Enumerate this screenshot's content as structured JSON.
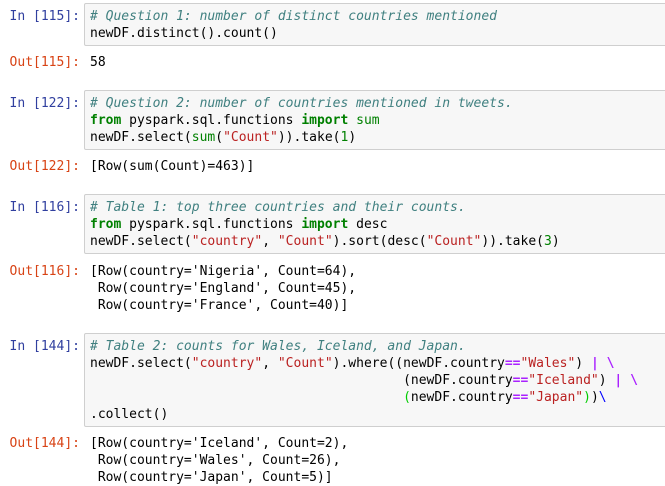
{
  "cells": [
    {
      "in_prompt": "In [115]:",
      "out_prompt": "Out[115]:",
      "code": [
        "# Question 1: number of distinct countries mentioned",
        "newDF.distinct().count()"
      ],
      "output": [
        "58"
      ]
    },
    {
      "in_prompt": "In [122]:",
      "out_prompt": "Out[122]:",
      "code": [
        "# Question 2: number of countries mentioned in tweets.",
        "from pyspark.sql.functions import sum",
        "newDF.select(sum(\"Count\")).take(1)"
      ],
      "output": [
        "[Row(sum(Count)=463)]"
      ]
    },
    {
      "in_prompt": "In [116]:",
      "out_prompt": "Out[116]:",
      "code": [
        "# Table 1: top three countries and their counts.",
        "from pyspark.sql.functions import desc",
        "newDF.select(\"country\", \"Count\").sort(desc(\"Count\")).take(3)"
      ],
      "output": [
        "[Row(country='Nigeria', Count=64),",
        " Row(country='England', Count=45),",
        " Row(country='France', Count=40)]"
      ]
    },
    {
      "in_prompt": "In [144]:",
      "out_prompt": "Out[144]:",
      "code": [
        "# Table 2: counts for Wales, Iceland, and Japan.",
        "newDF.select(\"country\", \"Count\").where((newDF.country==\"Wales\") | \\",
        "                                        (newDF.country==\"Iceland\") | \\",
        "                                        (newDF.country==\"Japan\"))\\",
        ".collect()"
      ],
      "output": [
        "[Row(country='Iceland', Count=2),",
        " Row(country='Wales', Count=26),",
        " Row(country='Japan', Count=5)]"
      ]
    }
  ]
}
